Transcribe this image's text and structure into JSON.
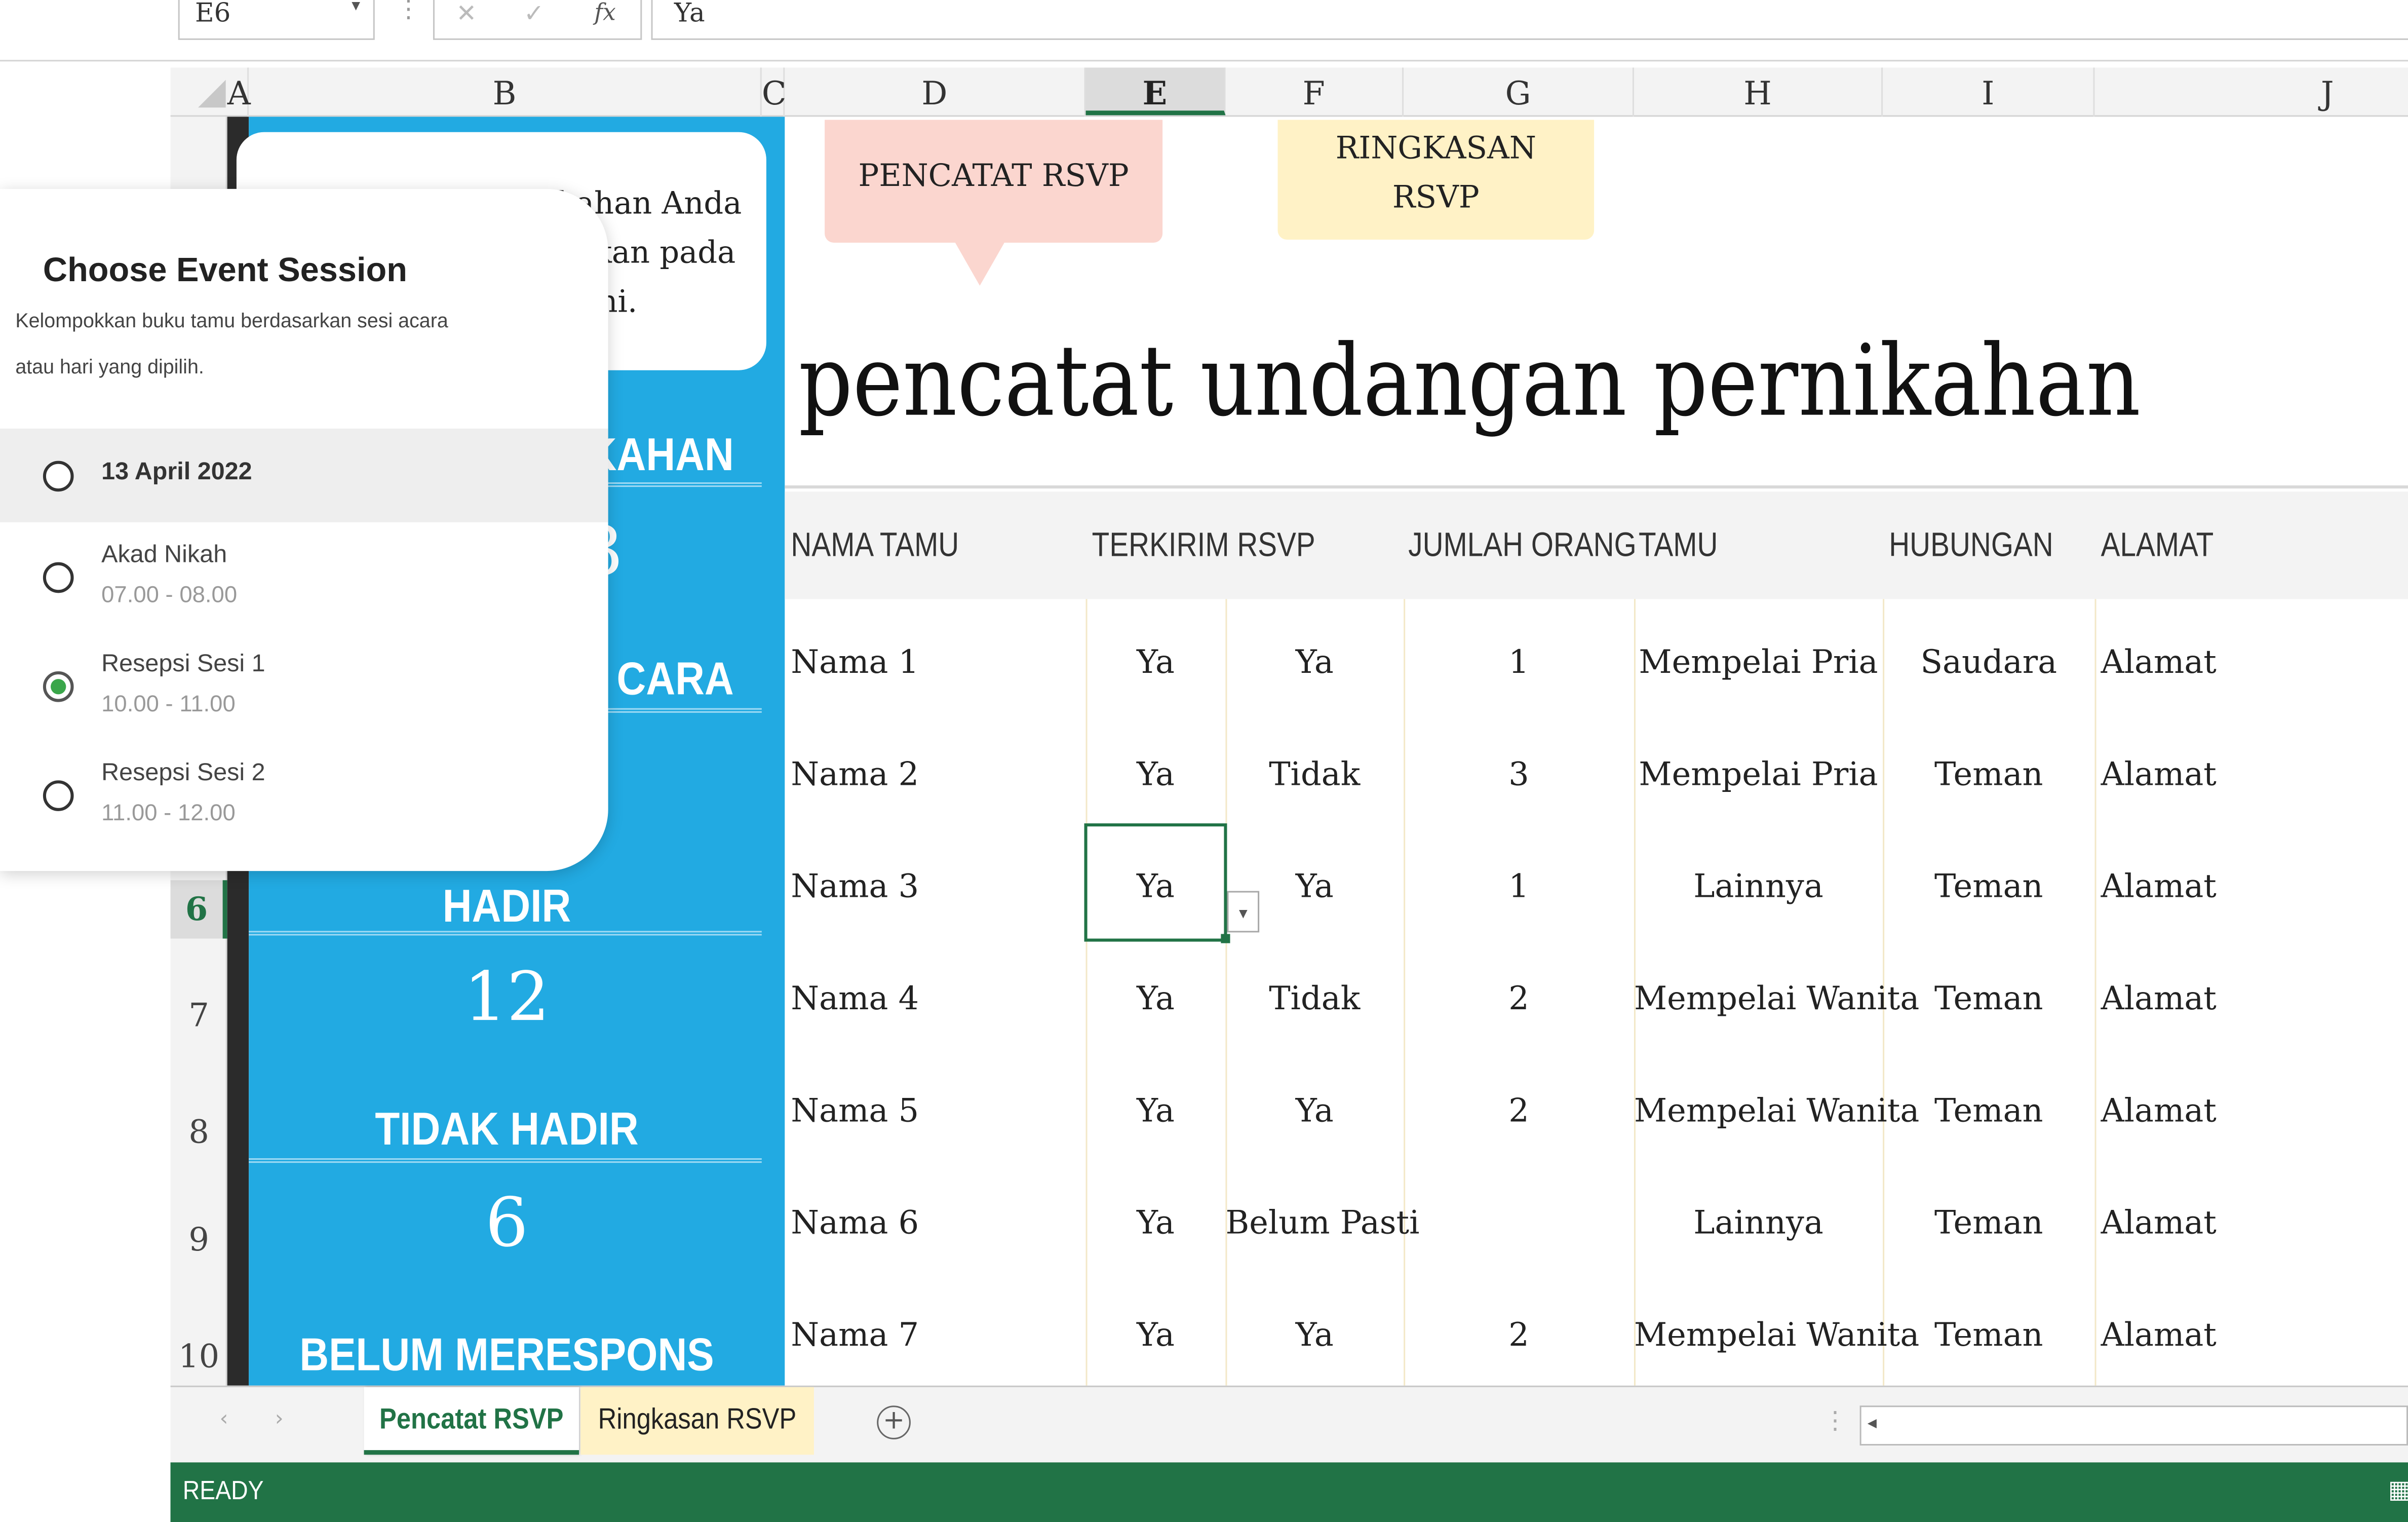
{
  "formula_bar": {
    "name_box": "E6",
    "cancel_glyph": "✕",
    "enter_glyph": "✓",
    "fx_label": "fx",
    "formula_value": "Ya"
  },
  "columns": [
    "A",
    "B",
    "C",
    "D",
    "E",
    "F",
    "G",
    "H",
    "I",
    "J"
  ],
  "rows": [
    "6",
    "7",
    "8",
    "9",
    "10"
  ],
  "callouts": {
    "pencatat": "PENCATAT RSVP",
    "ringkasan_line1": "RINGKASAN",
    "ringkasan_line2": "RSVP"
  },
  "sheet_title": "pencatat undangan pernikahan",
  "card_text": {
    "line1": "ikahan Anda",
    "line2": "ikan pada",
    "line3": "ni."
  },
  "side_panel": {
    "label_pernikahan": "KAHAN",
    "number_top": "3",
    "label_acara": "CARA",
    "label_hadir": "HADIR",
    "hadir_count": "12",
    "label_tidak_hadir": "TIDAK HADIR",
    "tidak_hadir_count": "6",
    "label_belum": "BELUM MERESPONS"
  },
  "table": {
    "headers": {
      "nama": "NAMA TAMU",
      "terkirim": "TERKIRIM RSVP",
      "jumlah": "JUMLAH ORANG",
      "tamu": "TAMU",
      "hubungan": "HUBUNGAN",
      "alamat": "ALAMAT"
    },
    "rows": [
      {
        "nama": "Nama 1",
        "terkirim": "Ya",
        "respon": "Ya",
        "jumlah": "1",
        "tamu": "Mempelai Pria",
        "hubungan": "Saudara",
        "alamat": "Alamat"
      },
      {
        "nama": "Nama 2",
        "terkirim": "Ya",
        "respon": "Tidak",
        "jumlah": "3",
        "tamu": "Mempelai Pria",
        "hubungan": "Teman",
        "alamat": "Alamat"
      },
      {
        "nama": "Nama 3",
        "terkirim": "Ya",
        "respon": "Ya",
        "jumlah": "1",
        "tamu": "Lainnya",
        "hubungan": "Teman",
        "alamat": "Alamat"
      },
      {
        "nama": "Nama 4",
        "terkirim": "Ya",
        "respon": "Tidak",
        "jumlah": "2",
        "tamu": "Mempelai Wanita",
        "hubungan": "Teman",
        "alamat": "Alamat"
      },
      {
        "nama": "Nama 5",
        "terkirim": "Ya",
        "respon": "Ya",
        "jumlah": "2",
        "tamu": "Mempelai Wanita",
        "hubungan": "Teman",
        "alamat": "Alamat"
      },
      {
        "nama": "Nama 6",
        "terkirim": "Ya",
        "respon": "Belum Pasti",
        "jumlah": "",
        "tamu": "Lainnya",
        "hubungan": "Teman",
        "alamat": "Alamat"
      },
      {
        "nama": "Nama 7",
        "terkirim": "Ya",
        "respon": "Ya",
        "jumlah": "2",
        "tamu": "Mempelai Wanita",
        "hubungan": "Teman",
        "alamat": "Alamat"
      }
    ]
  },
  "tabs": {
    "active": "Pencatat RSVP",
    "second": "Ringkasan RSVP",
    "add_glyph": "+"
  },
  "status": "READY",
  "popup": {
    "title": "Choose Event Session",
    "description_line1": "Kelompokkan buku tamu berdasarkan sesi acara",
    "description_line2": "atau hari yang dipilih.",
    "date_label": "13 April 2022",
    "options": [
      {
        "label": "Akad Nikah",
        "time": "07.00 - 08.00"
      },
      {
        "label": "Resepsi Sesi 1",
        "time": "10.00 - 11.00"
      },
      {
        "label": "Resepsi Sesi 2",
        "time": "11.00 - 12.00"
      }
    ],
    "selected_option": "Resepsi Sesi 1"
  },
  "colors": {
    "excel_green": "#217346",
    "side_blue": "#22aae2",
    "callout_pink": "#fbd6cf",
    "callout_yellow": "#fff2c6",
    "tab_yellow": "#fff2c6",
    "radio_green": "#3aa64a"
  }
}
